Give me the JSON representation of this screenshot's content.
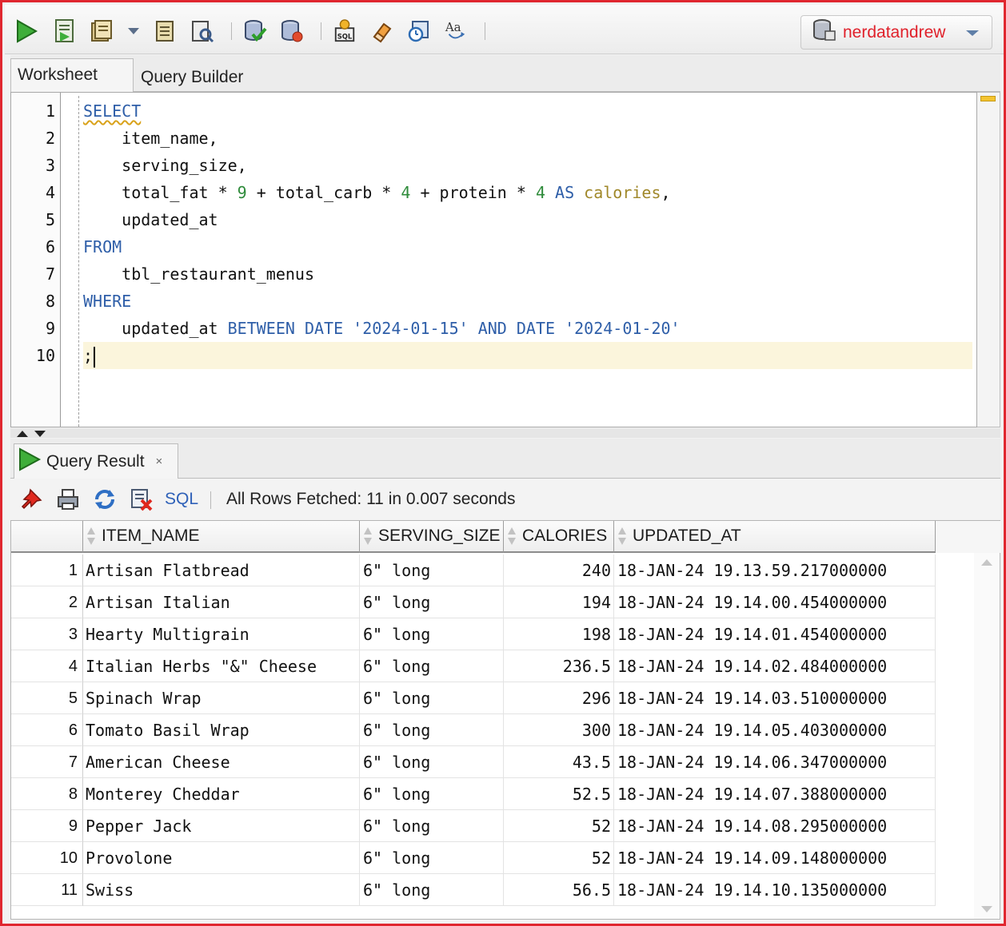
{
  "toolbar": {
    "icons": [
      "run-statement-icon",
      "run-script-icon",
      "autotrace-icon",
      "dropdown-arrow-icon",
      "explain-plan-icon",
      "sql-tuning-icon",
      "commit-icon",
      "rollback-icon",
      "sql-history-icon",
      "clear-icon",
      "schedule-icon",
      "format-case-icon"
    ],
    "connection": "nerdatandrew"
  },
  "editor_tabs": [
    "Worksheet",
    "Query Builder"
  ],
  "editor": {
    "line_numbers": [
      "1",
      "2",
      "3",
      "4",
      "5",
      "6",
      "7",
      "8",
      "9",
      "10"
    ],
    "lines": {
      "l1_kw": "SELECT",
      "l2": "    item_name,",
      "l3": "    serving_size,",
      "l4_a": "    total_fat * ",
      "l4_n1": "9",
      "l4_b": " + total_carb * ",
      "l4_n2": "4",
      "l4_c": " + protein * ",
      "l4_n3": "4",
      "l4_kw": " AS ",
      "l4_alias": "calories",
      "l4_end": ",",
      "l5": "    updated_at",
      "l6_kw": "FROM",
      "l7": "    tbl_restaurant_menus",
      "l8_kw": "WHERE",
      "l9_a": "    updated_at ",
      "l9_kw1": "BETWEEN DATE ",
      "l9_s1": "'2024-01-15'",
      "l9_kw2": " AND DATE ",
      "l9_s2": "'2024-01-20'",
      "l10": ";"
    },
    "colors": {
      "keyword": "#2e5ea8",
      "number": "#2e8b3a",
      "alias": "#a0882a",
      "current_line": "#fbf5dc"
    }
  },
  "results": {
    "tab_label": "Query Result",
    "tab_close": "×",
    "sql_link": "SQL",
    "status": "All Rows Fetched: 11 in 0.007 seconds",
    "columns": [
      "ITEM_NAME",
      "SERVING_SIZE",
      "CALORIES",
      "UPDATED_AT"
    ],
    "rows": [
      [
        "1",
        "Artisan Flatbread",
        "6\" long",
        "240",
        "18-JAN-24 19.13.59.217000000"
      ],
      [
        "2",
        "Artisan Italian",
        "6\" long",
        "194",
        "18-JAN-24 19.14.00.454000000"
      ],
      [
        "3",
        "Hearty Multigrain",
        "6\" long",
        "198",
        "18-JAN-24 19.14.01.454000000"
      ],
      [
        "4",
        "Italian Herbs \"&\" Cheese",
        "6\" long",
        "236.5",
        "18-JAN-24 19.14.02.484000000"
      ],
      [
        "5",
        "Spinach Wrap",
        "6\" long",
        "296",
        "18-JAN-24 19.14.03.510000000"
      ],
      [
        "6",
        "Tomato Basil Wrap",
        "6\" long",
        "300",
        "18-JAN-24 19.14.05.403000000"
      ],
      [
        "7",
        "American Cheese",
        "6\" long",
        "43.5",
        "18-JAN-24 19.14.06.347000000"
      ],
      [
        "8",
        "Monterey Cheddar",
        "6\" long",
        "52.5",
        "18-JAN-24 19.14.07.388000000"
      ],
      [
        "9",
        "Pepper Jack",
        "6\" long",
        "52",
        "18-JAN-24 19.14.08.295000000"
      ],
      [
        "10",
        "Provolone",
        "6\" long",
        "52",
        "18-JAN-24 19.14.09.148000000"
      ],
      [
        "11",
        "Swiss",
        "6\" long",
        "56.5",
        "18-JAN-24 19.14.10.135000000"
      ]
    ]
  }
}
